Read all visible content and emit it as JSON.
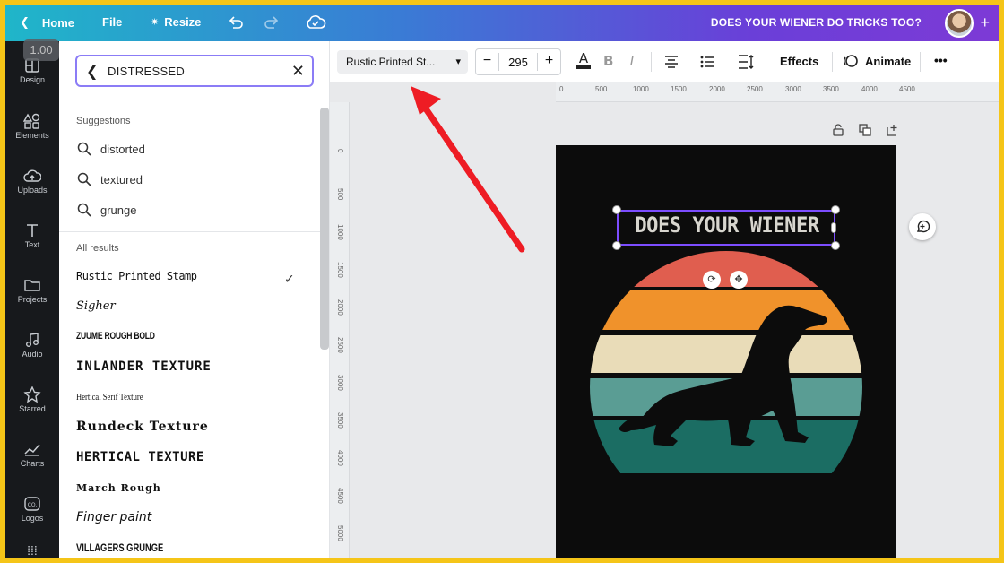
{
  "topbar": {
    "home": "Home",
    "file": "File",
    "resize": "Resize",
    "doc_title": "DOES YOUR WIENER DO TRICKS TOO?",
    "colors": {
      "start": "#1fb6c9",
      "end": "#7d3ad6"
    }
  },
  "zoom": "1.00",
  "rail": [
    {
      "label": "Design",
      "icon": "layout-icon"
    },
    {
      "label": "Elements",
      "icon": "shapes-icon"
    },
    {
      "label": "Uploads",
      "icon": "cloud-upload-icon"
    },
    {
      "label": "Text",
      "icon": "text-icon"
    },
    {
      "label": "Projects",
      "icon": "folder-icon"
    },
    {
      "label": "Audio",
      "icon": "music-icon"
    },
    {
      "label": "Starred",
      "icon": "star-icon"
    },
    {
      "label": "Charts",
      "icon": "chart-icon"
    },
    {
      "label": "Logos",
      "icon": "logo-icon"
    }
  ],
  "panel": {
    "search_value": "DISTRESSED",
    "suggestions_label": "Suggestions",
    "suggestions": [
      "distorted",
      "textured",
      "grunge"
    ],
    "results_label": "All results",
    "fonts": [
      "Rustic Printed Stamp",
      "Sigher",
      "ZUUME ROUGH BOLD",
      "INLANDER TEXTURE",
      "Hertical Serif Texture",
      "Rundeck Texture",
      "HERTICAL TEXTURE",
      "March Rough",
      "Finger paint",
      "VILLAGERS GRUNGE"
    ]
  },
  "toolbar": {
    "font_name": "Rustic Printed St...",
    "font_size": "295",
    "effects": "Effects",
    "animate": "Animate",
    "more": "•••"
  },
  "ruler": {
    "h_ticks": [
      "0",
      "500",
      "1000",
      "1500",
      "2000",
      "2500",
      "3000",
      "3500",
      "4000",
      "4500"
    ],
    "v_ticks": [
      "0",
      "500",
      "1000",
      "1500",
      "2000",
      "2500",
      "3000",
      "3500",
      "4000",
      "4500",
      "5000"
    ]
  },
  "design": {
    "headline": "DOES YOUR WIENER",
    "stripe_colors": [
      "#e05e4f",
      "#f0922b",
      "#e9dcb8",
      "#5a9d94",
      "#1b6d63"
    ]
  },
  "annotation": {
    "arrow_color": "#ee1c24"
  }
}
